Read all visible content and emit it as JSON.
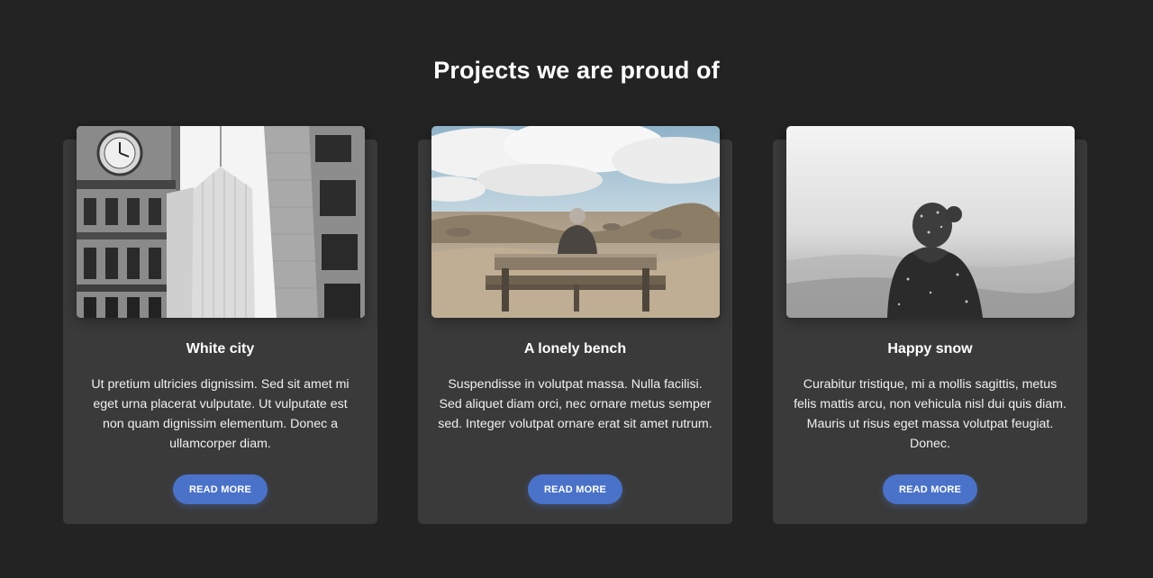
{
  "section": {
    "title": "Projects we are proud of"
  },
  "cards": [
    {
      "title": "White city",
      "text": "Ut pretium ultricies dignissim. Sed sit amet mi eget urna placerat vulputate. Ut vulputate est non quam dignissim elementum. Donec a ullamcorper diam.",
      "button_label": "READ MORE",
      "image_name": "white-city-photo"
    },
    {
      "title": "A lonely bench",
      "text": "Suspendisse in volutpat massa. Nulla facilisi. Sed aliquet diam orci, nec ornare metus semper sed. Integer volutpat ornare erat sit amet rutrum.",
      "button_label": "READ MORE",
      "image_name": "lonely-bench-photo"
    },
    {
      "title": "Happy snow",
      "text": "Curabitur tristique, mi a mollis sagittis, metus felis mattis arcu, non vehicula nisl dui quis diam. Mauris ut risus eget massa volutpat feugiat. Donec.",
      "button_label": "READ MORE",
      "image_name": "happy-snow-photo"
    }
  ],
  "colors": {
    "background": "#232323",
    "card": "#3a3a3a",
    "button": "#4a72c9"
  }
}
